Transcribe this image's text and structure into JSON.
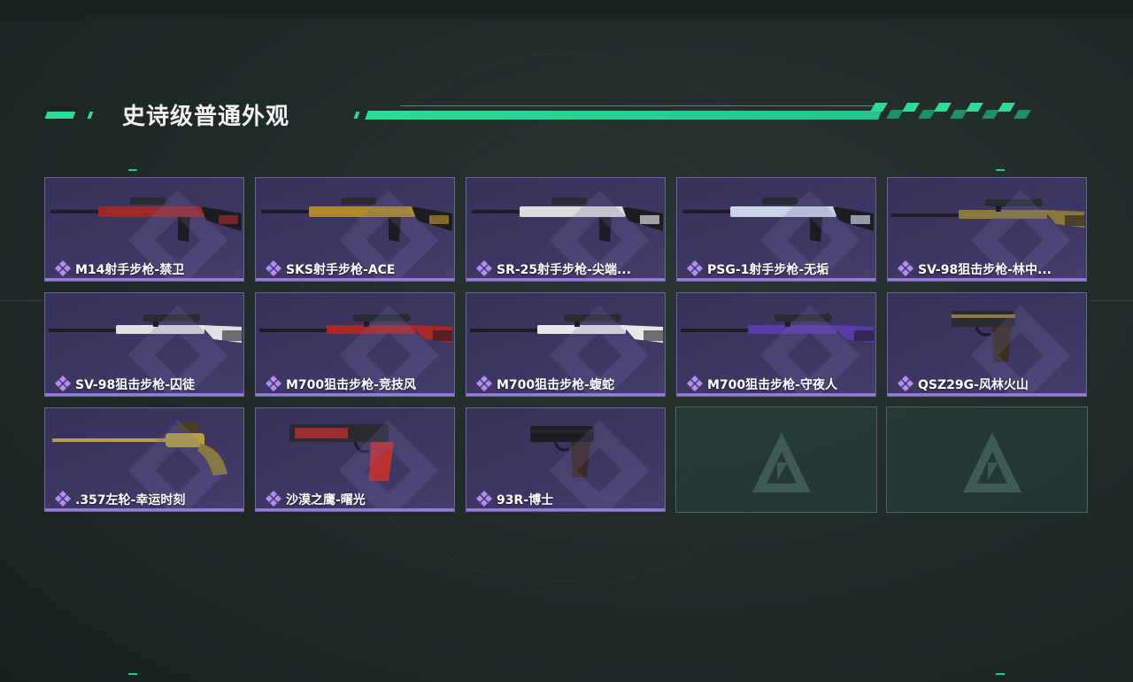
{
  "section": {
    "title": "史诗级普通外观"
  },
  "colors": {
    "accent_green": "#2fd996",
    "card_purple": "#3d3763",
    "rarity_purple": "#9b77e0"
  },
  "rarity_icon": "purple-diamond-icon",
  "empty_slot_icon": "triangle-logo-icon",
  "items": [
    {
      "label": "M14射手步枪-禁卫",
      "palette": "#9a2a2a"
    },
    {
      "label": "SKS射手步枪-ACE",
      "palette": "#b08a2a"
    },
    {
      "label": "SR-25射手步枪-尖端...",
      "palette": "#dcdcdc"
    },
    {
      "label": "PSG-1射手步枪-无垢",
      "palette": "#c8d4e8"
    },
    {
      "label": "SV-98狙击步枪-林中...",
      "palette": "#8a7a3a"
    },
    {
      "label": "SV-98狙击步枪-囚徒",
      "palette": "#e0e0e0"
    },
    {
      "label": "M700狙击步枪-竞技风",
      "palette": "#a82828"
    },
    {
      "label": "M700狙击步枪-蝮蛇",
      "palette": "#e8e8e8"
    },
    {
      "label": "M700狙击步枪-守夜人",
      "palette": "#5a3aa8"
    },
    {
      "label": "QSZ29G-风林火山",
      "palette": "#b89a4a"
    },
    {
      "label": ".357左轮-幸运时刻",
      "palette": "#b8a040"
    },
    {
      "label": "沙漠之鹰-曙光",
      "palette": "#b83030"
    },
    {
      "label": "93R-博士",
      "palette": "#2a2a2a"
    }
  ]
}
